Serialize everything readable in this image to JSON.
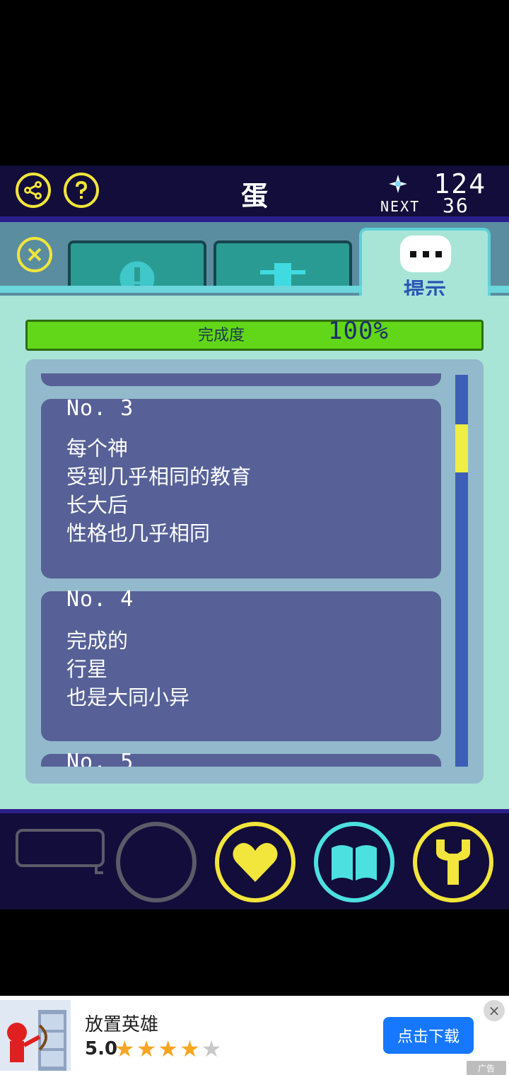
{
  "header": {
    "title": "蛋",
    "share_icon": "share-icon",
    "help_icon": "help-icon",
    "gem_icon": "sparkle-star-icon",
    "gem_count": "124",
    "next_label": "NEXT",
    "next_value": "36"
  },
  "tabs": {
    "close_icon": "close-icon",
    "items": [
      {
        "icon": "exclamation-icon",
        "active": false
      },
      {
        "icon": "arrow-up-icon",
        "active": false
      },
      {
        "icon": "speech-bubble-icon",
        "label": "提示",
        "active": true
      }
    ]
  },
  "progress": {
    "label": "完成度",
    "value_text": "100%",
    "value": 1.0
  },
  "hints": [
    {
      "no": "No. 3",
      "lines": [
        "每个神",
        "受到几乎相同的教育",
        "长大后",
        "性格也几乎相同"
      ]
    },
    {
      "no": "No. 4",
      "lines": [
        "完成的",
        "行星",
        "也是大同小异"
      ]
    },
    {
      "no": "No. 5",
      "lines": []
    }
  ],
  "bottom_bar": {
    "buttons": [
      {
        "icon": "speech-bubble-icon",
        "enabled": false
      },
      {
        "icon": "empty-circle-icon",
        "enabled": false
      },
      {
        "icon": "heart-icon",
        "color": "#f2e53b"
      },
      {
        "icon": "book-icon",
        "color": "#4ce0e0"
      },
      {
        "icon": "wrench-icon",
        "color": "#f2e53b"
      }
    ]
  },
  "ad": {
    "title": "放置英雄",
    "rating": "5.0",
    "stars_filled": 4,
    "stars_total": 5,
    "cta": "点击下载",
    "close_icon": "close-icon",
    "tag": "广告"
  },
  "colors": {
    "accent_yellow": "#f2e53b",
    "accent_cyan": "#4ce0e0",
    "header_bg": "#120d3a",
    "panel_bg": "#a8e5d7",
    "card_bg": "#576197",
    "progress_green": "#62d619",
    "cta_blue": "#1677ff"
  }
}
